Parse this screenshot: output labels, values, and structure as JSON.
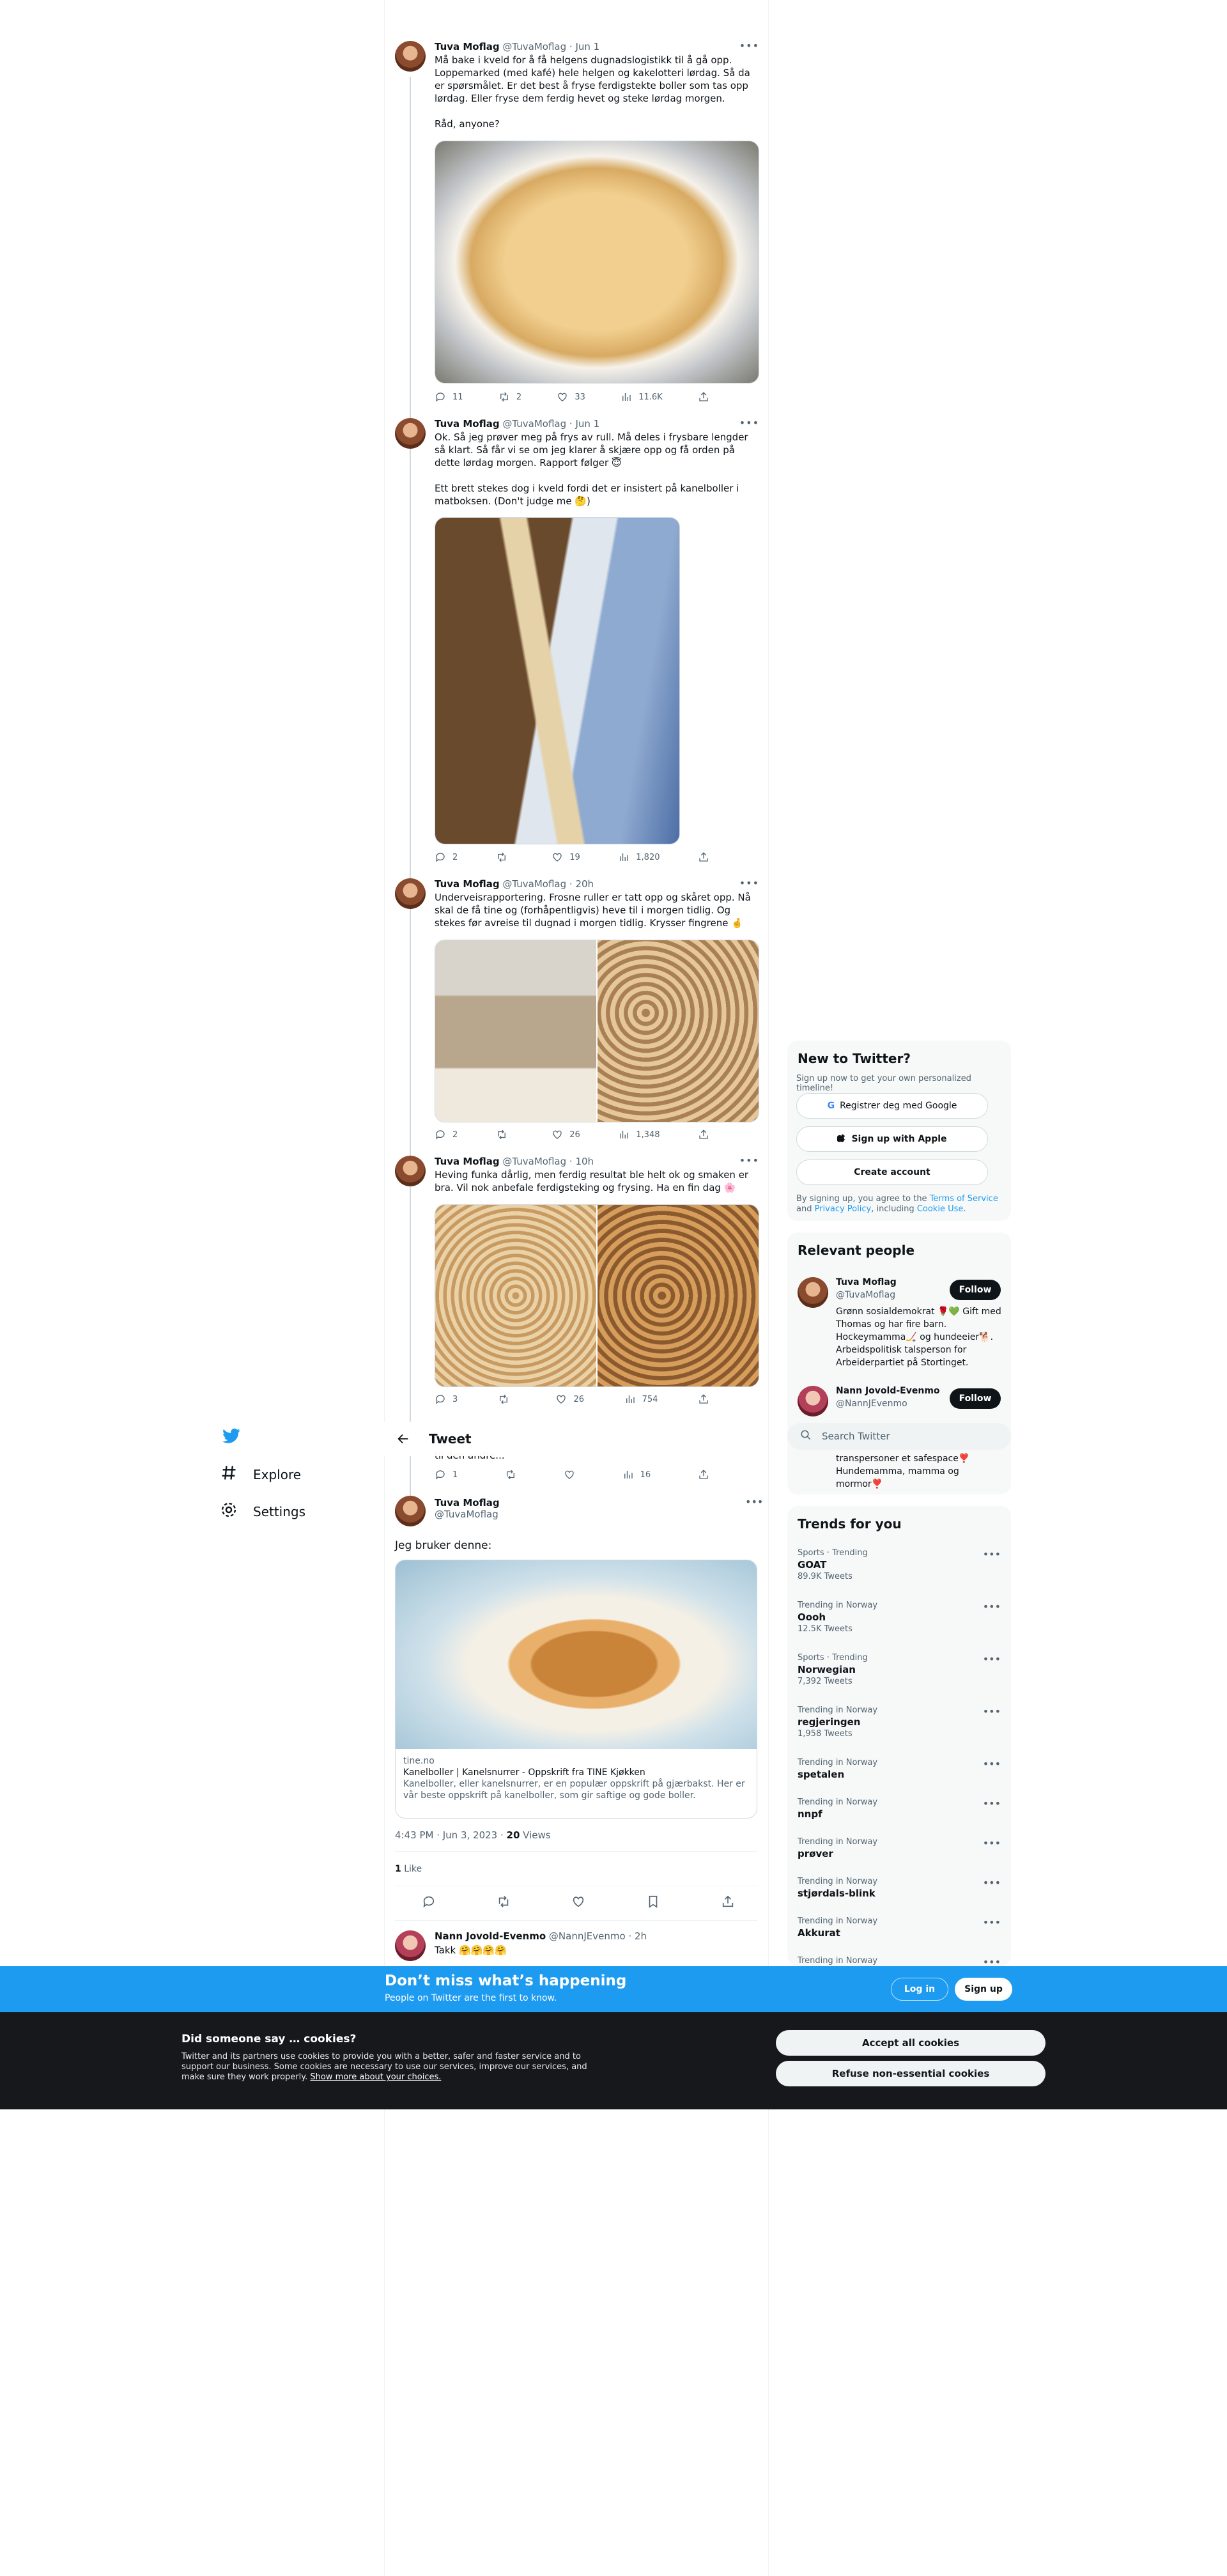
{
  "nav": {
    "explore": "Explore",
    "settings": "Settings"
  },
  "thread": [
    {
      "name": "Tuva Moflag",
      "handle": "@TuvaMoflag",
      "time": "· Jun 1",
      "text": "Må bake i kveld for å få helgens dugnadslogistikk til å gå opp. Loppemarked (med kafé) hele helgen og kakelotteri lørdag. Så da er spørsmålet. Er det best å fryse ferdigstekte boller som tas opp lørdag. Eller fryse dem ferdig hevet og steke lørdag morgen.\n\nRåd, anyone?",
      "replies": "11",
      "retweets": "2",
      "likes": "33",
      "views": "11.6K"
    },
    {
      "name": "Tuva Moflag",
      "handle": "@TuvaMoflag",
      "time": "· Jun 1",
      "text": "Ok. Så jeg prøver meg på frys av rull. Må deles i frysbare lengder så klart. Så får vi se om jeg klarer å skjære opp og få orden på dette lørdag morgen. Rapport følger 😇\n\nEtt brett stekes dog i kveld fordi det er insistert på kanelboller i matboksen. (Don't judge me 🤔)",
      "replies": "2",
      "retweets": "",
      "likes": "19",
      "views": "1,820"
    },
    {
      "name": "Tuva Moflag",
      "handle": "@TuvaMoflag",
      "time": "· 20h",
      "text": "Underveisrapportering. Frosne ruller er tatt opp og skåret opp. Nå skal de få tine og (forhåpentligvis) heve til i morgen tidlig. Og stekes før avreise til dugnad i morgen tidlig. Krysser fingrene 🤞",
      "replies": "2",
      "retweets": "",
      "likes": "26",
      "views": "1,348"
    },
    {
      "name": "Tuva Moflag",
      "handle": "@TuvaMoflag",
      "time": "· 10h",
      "text": "Heving funka dårlig, men ferdig resultat ble helt ok og smaken er bra. Vil nok anbefale ferdigsteking og frysing. Ha en fin dag 🌸",
      "replies": "3",
      "retweets": "",
      "likes": "26",
      "views": "754"
    }
  ],
  "partial": {
    "text": "til den andre...",
    "replies": "1",
    "views": "16"
  },
  "header": {
    "title": "Tweet"
  },
  "main_tweet": {
    "name": "Tuva Moflag",
    "handle": "@TuvaMoflag",
    "text": "Jeg bruker denne:",
    "card_domain": "tine.no",
    "card_title": "Kanelboller | Kanelsnurrer - Oppskrift fra TINE Kjøkken",
    "card_desc": "Kanelboller, eller kanelsnurrer, er en populær oppskrift på gjærbakst. Her er vår beste oppskrift på kanelboller, som gir saftige og gode boller.",
    "timestamp": "4:43 PM · Jun 3, 2023 · ",
    "views_count": "20",
    "views_label": " Views",
    "likes_count": "1",
    "likes_label": " Like"
  },
  "reply": {
    "name": "Nann Jovold-Evenmo",
    "handle": "@NannJEvenmo",
    "time": "· 2h",
    "text": "Takk 🤗🤗🤗🤗"
  },
  "new_to_twitter": {
    "title": "New to Twitter?",
    "subtitle": "Sign up now to get your own personalized timeline!",
    "google": "Registrer deg med Google",
    "apple": "Sign up with Apple",
    "create": "Create account",
    "legal_1": "By signing up, you agree to the ",
    "terms": "Terms of Service",
    "legal_2": " and ",
    "privacy": "Privacy Policy",
    "legal_3": ", including ",
    "cookie": "Cookie Use",
    "legal_4": "."
  },
  "relevant": {
    "title": "Relevant people",
    "people": [
      {
        "name": "Tuva Moflag",
        "handle": "@TuvaMoflag",
        "bio": "Grønn sosialdemokrat 🌹💚 Gift med Thomas og har fire barn. Hockeymamma🏒 og hundeeier🐕. Arbeidspolitisk talsperson for Arbeiderpartiet på Stortinget.",
        "follow": "Follow"
      },
      {
        "name": "Nann Jovold-Evenmo",
        "handle": "@NannJEvenmo",
        "bio_tail": "transpersoner et safespace❣️ Hundemamma, mamma og mormor❣️",
        "follow": "Follow"
      }
    ]
  },
  "search": {
    "placeholder": "Search Twitter"
  },
  "trends": {
    "title": "Trends for you",
    "items": [
      {
        "category": "Sports · Trending",
        "name": "GOAT",
        "count": "89.9K Tweets"
      },
      {
        "category": "Trending in Norway",
        "name": "Oooh",
        "count": "12.5K Tweets"
      },
      {
        "category": "Sports · Trending",
        "name": "Norwegian",
        "count": "7,392 Tweets"
      },
      {
        "category": "Trending in Norway",
        "name": "regjeringen",
        "count": "1,958 Tweets"
      },
      {
        "category": "Trending in Norway",
        "name": "spetalen",
        "count": ""
      },
      {
        "category": "Trending in Norway",
        "name": "nnpf",
        "count": ""
      },
      {
        "category": "Trending in Norway",
        "name": "prøver",
        "count": ""
      },
      {
        "category": "Trending in Norway",
        "name": "stjørdals-blink",
        "count": ""
      },
      {
        "category": "Trending in Norway",
        "name": "Akkurat",
        "count": ""
      },
      {
        "category": "Trending in Norway",
        "name": "",
        "count": ""
      }
    ]
  },
  "signup_bar": {
    "title": "Don’t miss what’s happening",
    "subtitle": "People on Twitter are the first to know.",
    "login": "Log in",
    "signup": "Sign up"
  },
  "cookies": {
    "title": "Did someone say … cookies?",
    "body": "Twitter and its partners use cookies to provide you with a better, safer and faster service and to support our business. Some cookies are necessary to use our services, improve our services, and make sure they work properly. ",
    "link": "Show more about your choices.",
    "accept": "Accept all cookies",
    "refuse": "Refuse non-essential cookies"
  },
  "colors": {
    "accent": "#1d9bf0",
    "text": "#0f1419",
    "muted": "#536471",
    "cookie_bg": "#16181c"
  }
}
